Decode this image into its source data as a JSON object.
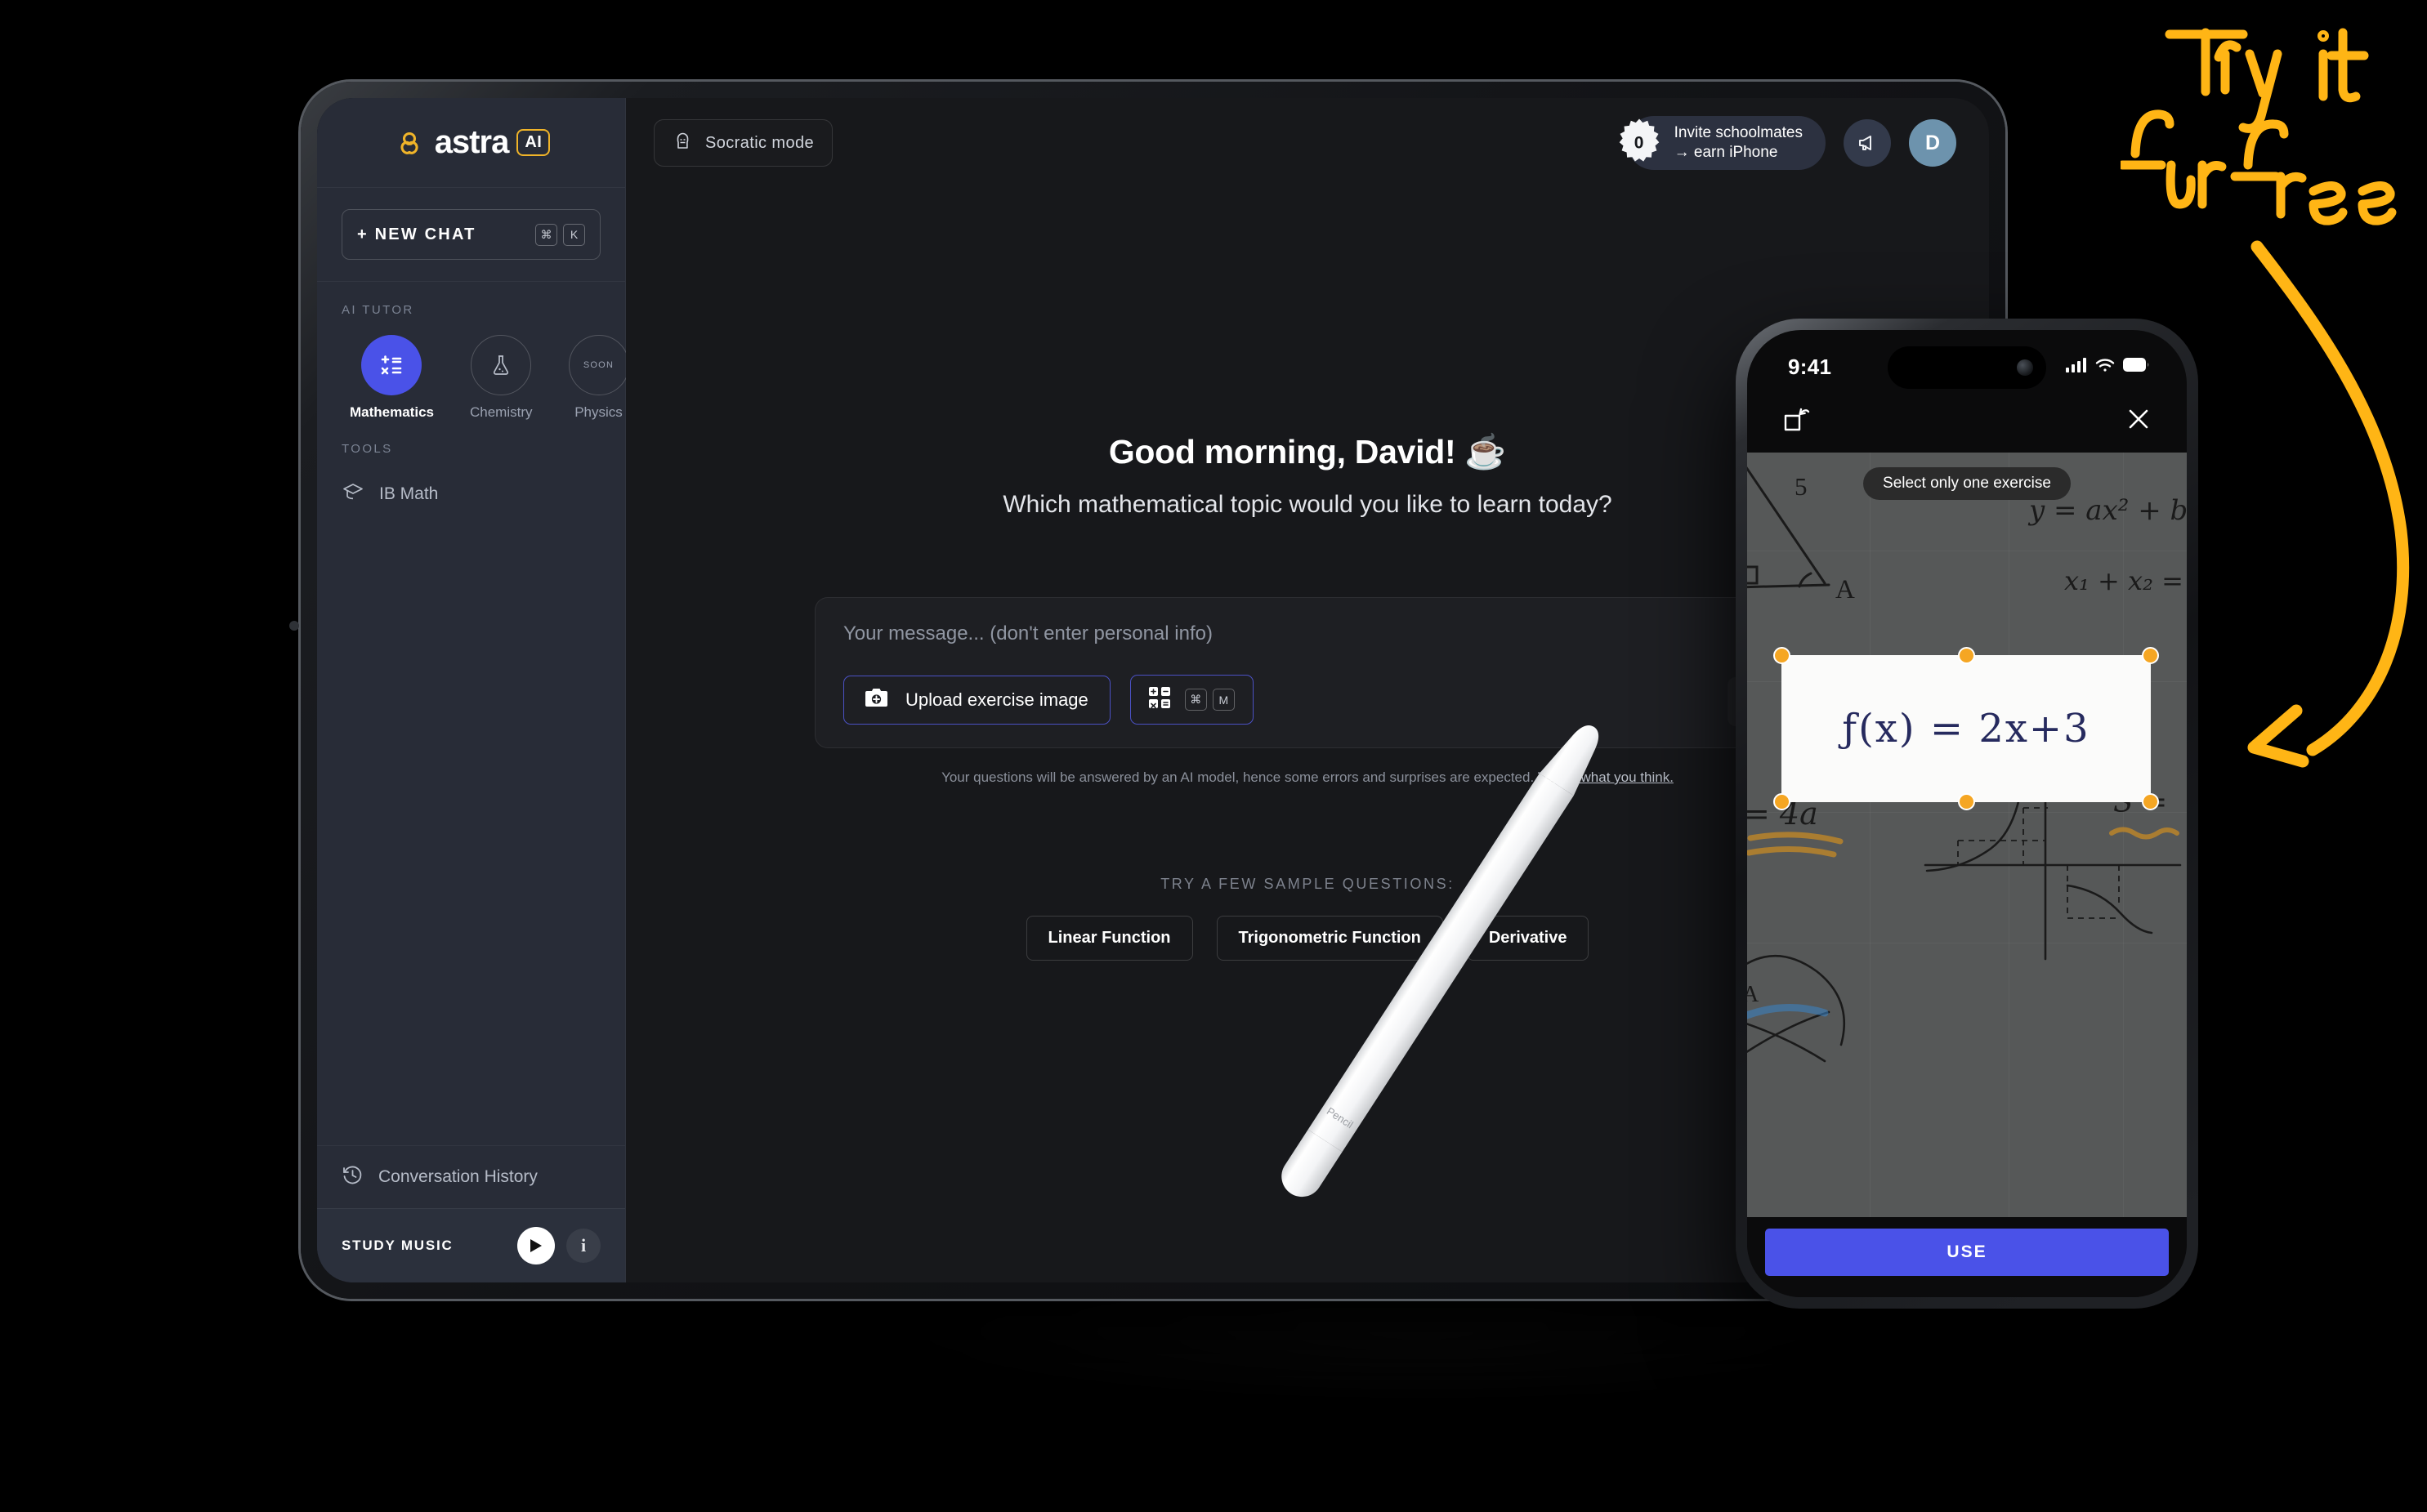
{
  "tablet": {
    "sidebar": {
      "logo": {
        "word": "astra",
        "badge": "AI",
        "mark_icon": "astra-trefoil-logo"
      },
      "new_chat": {
        "label": "+ NEW CHAT",
        "shortcut_keys": [
          "⌘",
          "K"
        ]
      },
      "ai_tutor_label": "AI TUTOR",
      "tutors": [
        {
          "name": "Mathematics",
          "icon": "math-operators-icon",
          "active": true,
          "badge": ""
        },
        {
          "name": "Chemistry",
          "icon": "flask-icon",
          "active": false,
          "badge": ""
        },
        {
          "name": "Physics",
          "icon": "",
          "active": false,
          "badge": "SOON"
        }
      ],
      "tools_label": "TOOLS",
      "tools": [
        {
          "label": "IB Math",
          "icon": "graduation-cap-icon"
        }
      ],
      "conversation_history": {
        "label": "Conversation History",
        "icon": "history-clock-icon"
      },
      "study_music": {
        "label": "STUDY MUSIC",
        "play_icon": "play-icon",
        "info_icon": "info-icon"
      }
    },
    "topbar": {
      "socratic": {
        "label": "Socratic mode",
        "icon": "socratic-bust-icon"
      },
      "invite": {
        "count": "0",
        "line1": "Invite schoolmates",
        "line2": "→ earn iPhone"
      },
      "megaphone_icon": "megaphone-icon",
      "avatar_initial": "D"
    },
    "main": {
      "greeting": "Good morning, David! ☕",
      "subgreeting": "Which mathematical topic would you like to learn today?",
      "composer": {
        "placeholder": "Your message... (don't enter personal info)",
        "upload_label": "Upload exercise image",
        "upload_icon": "camera-plus-icon",
        "math_mode_icon": "math-grid-icon",
        "math_mode_keys": [
          "⌘",
          "M"
        ],
        "send_icon": "send-sparkle-icon"
      },
      "disclaimer": {
        "text": "Your questions will be answered by an AI model, hence some errors and surprises are expected.",
        "link": "Tell us what you think."
      },
      "samples_label": "TRY A FEW SAMPLE QUESTIONS:",
      "samples": [
        "Linear Function",
        "Trigonometric Function",
        "Derivative"
      ]
    }
  },
  "phone": {
    "status": {
      "time": "9:41",
      "cellular_icon": "cellular-bars-icon",
      "wifi_icon": "wifi-icon",
      "battery_icon": "battery-icon"
    },
    "nav": {
      "rotate_icon": "rotate-crop-icon",
      "close_icon": "close-x-icon"
    },
    "tooltip": "Select only one exercise",
    "crop_selection": {
      "formula": "ƒ(x) = 2x+3",
      "handles": 6,
      "handle_color": "#f5a623"
    },
    "photo_annotations": [
      "5",
      "A",
      "y = ax² + b",
      "x₁ + x₂ =",
      "= 4a",
      "S =",
      "y",
      "A"
    ],
    "use_button": "USE"
  },
  "decor": {
    "handwritten_cta": "Try it for free",
    "cta_color": "#ffb515",
    "arrow_icon": "curved-arrow-icon",
    "pencil": {
      "label": "Pencil",
      "name": "apple-pencil"
    }
  },
  "colors": {
    "accent_blue": "#4a52e8",
    "accent_yellow": "#f0b429",
    "sidebar_bg": "#282c37",
    "main_bg": "#17181b"
  }
}
